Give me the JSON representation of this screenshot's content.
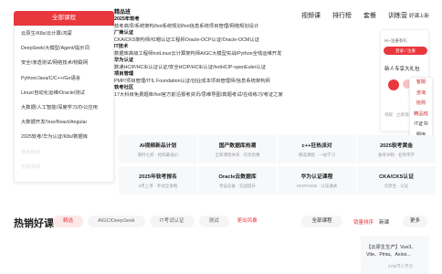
{
  "nav": {
    "items": [
      "视频课",
      "排行榜",
      "套餐",
      "训练营"
    ],
    "right": "好课上新"
  },
  "categories": {
    "header": "全部课程",
    "items": [
      "云原生/K8s/云计算/鸿蒙",
      "DeepSeek/大模型/Agent/提示词",
      "安全/渗透测试/网络技术/物联网",
      "Python/Java/C/C++/Go语言",
      "Linux/自动化运维/Oracle/测试",
      "大数据/人工智能/深度学习/办公应用",
      "大数据开发/Vue/React/Angular",
      "2025软考/华为认证/K8s/数据库",
      "技术培训",
      "在线测评"
    ]
  },
  "mega": {
    "top": "精品班",
    "lines": [
      {
        "text": "2025年软考",
        "strong": true
      },
      {
        "text": "软考高项/系统架构/hot系统规划/hot信息系统项目管理/网络规划设计",
        "strong": false
      },
      {
        "text": "厂商认证",
        "strong": true
      },
      {
        "text": "CKA/CKS架构师/红帽认证工程师Oracle-OCP认证/Oracle-OCM认证",
        "strong": false
      },
      {
        "text": "IT技术",
        "strong": true
      },
      {
        "text": "数据库高级工程师hotLinux云计算架构师AIGC大模型实战/Python全栈运维开发",
        "strong": false
      },
      {
        "text": "华为认证",
        "strong": true
      },
      {
        "text": "数通HCIP/HCIE认证认证/安全HCIP/HCIE认证/hotHCIP-openEuler认证",
        "strong": false
      },
      {
        "text": "项目管理",
        "strong": true
      },
      {
        "text": "PMP/项目管理/ITIL Foundation认证/创业成本项目管理师/信息系统架构师",
        "strong": false
      },
      {
        "text": "软考社区",
        "strong": true
      },
      {
        "text": "17大科目免费题库/hot官方前沿报考资讯/思维导图/真题考试/在线练习/考证之家",
        "strong": false
      }
    ]
  },
  "user_card": {
    "greeting": "Hi~注册有礼",
    "login": "登录 / 注册",
    "gift_title": "新人专享大礼包",
    "bottom": "领取 · 立即领取"
  },
  "side_tools": [
    {
      "label": "客服",
      "dark": false
    },
    {
      "label": "咨询",
      "dark": false
    },
    {
      "label": "抢购",
      "dark": false
    },
    {
      "label": "精品班",
      "dark": false
    },
    {
      "label": "IT证书",
      "dark": true
    },
    {
      "label": "题库",
      "dark": true
    }
  ],
  "cards": [
    {
      "title": "AI视频新品计划",
      "sub": "限时七折 · 抢购最低价"
    },
    {
      "title": "国产数据库热潮",
      "sub": "全新课程体系 · 尽享优惠"
    },
    {
      "title": "c++狂热派对",
      "sub": "精选课程 · 一站学习"
    },
    {
      "title": "2025软考黄金",
      "sub": "备考冲刺 · 名师带学"
    },
    {
      "title": "2025年软考报名",
      "sub": "5月上考 · 考试全攻略"
    },
    {
      "title": "Oracle云数据库",
      "sub": "考证必备 · 实战提升"
    },
    {
      "title": "华为认证课程",
      "sub": "HCIP/HCIE · 认证通关"
    },
    {
      "title": "CKA/CKS认证",
      "sub": "云原生 · 认证"
    }
  ],
  "hot": {
    "title": "热销好课",
    "tabs": [
      {
        "label": "精选",
        "active": true
      },
      {
        "label": "AIGC/DeepSeek",
        "active": false
      },
      {
        "label": "IT考试认证",
        "active": false
      },
      {
        "label": "测试",
        "active": false
      }
    ],
    "red_link": "更出风暴",
    "right_all": "全部课程",
    "right_a": "销量排序",
    "right_b": "新课",
    "right_more": "更多",
    "card_title": "【云原生生产】Vue3、Vite、Pinia、Axios...",
    "card_sub": "2720节人学习"
  }
}
